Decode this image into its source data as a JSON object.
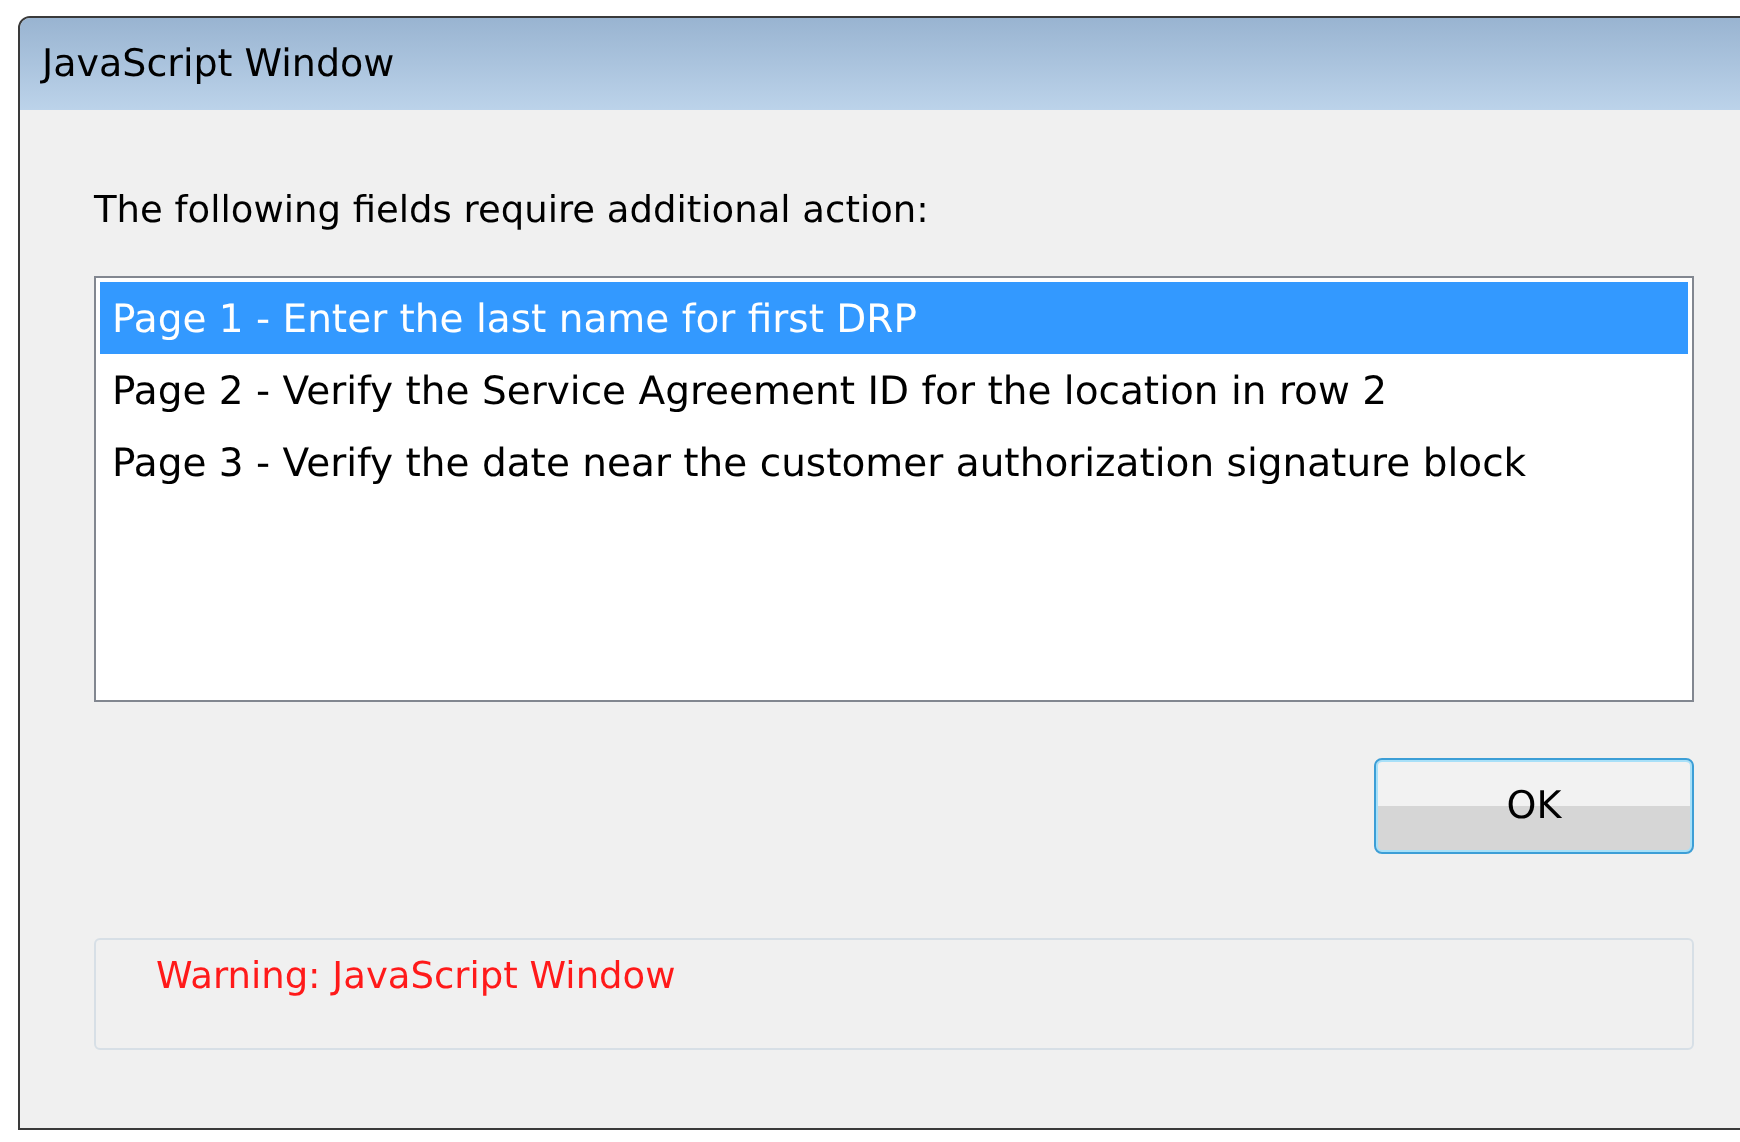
{
  "window": {
    "title": "JavaScript Window"
  },
  "message": "The following fields require additional action:",
  "items": [
    {
      "label": "Page 1 - Enter the last name for first DRP",
      "selected": true
    },
    {
      "label": "Page 2 - Verify the Service Agreement ID for the location in row 2",
      "selected": false
    },
    {
      "label": "Page 3 - Verify the date near the customer authorization signature block",
      "selected": false
    }
  ],
  "buttons": [
    "OK"
  ],
  "warning": "Warning: JavaScript Window"
}
